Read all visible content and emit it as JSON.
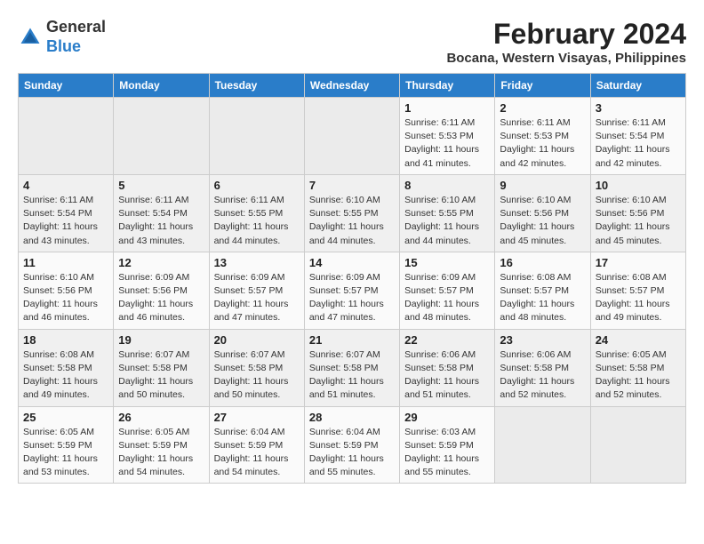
{
  "header": {
    "logo_line1": "General",
    "logo_line2": "Blue",
    "month_year": "February 2024",
    "location": "Bocana, Western Visayas, Philippines"
  },
  "weekdays": [
    "Sunday",
    "Monday",
    "Tuesday",
    "Wednesday",
    "Thursday",
    "Friday",
    "Saturday"
  ],
  "weeks": [
    [
      {
        "day": "",
        "info": ""
      },
      {
        "day": "",
        "info": ""
      },
      {
        "day": "",
        "info": ""
      },
      {
        "day": "",
        "info": ""
      },
      {
        "day": "1",
        "info": "Sunrise: 6:11 AM\nSunset: 5:53 PM\nDaylight: 11 hours\nand 41 minutes."
      },
      {
        "day": "2",
        "info": "Sunrise: 6:11 AM\nSunset: 5:53 PM\nDaylight: 11 hours\nand 42 minutes."
      },
      {
        "day": "3",
        "info": "Sunrise: 6:11 AM\nSunset: 5:54 PM\nDaylight: 11 hours\nand 42 minutes."
      }
    ],
    [
      {
        "day": "4",
        "info": "Sunrise: 6:11 AM\nSunset: 5:54 PM\nDaylight: 11 hours\nand 43 minutes."
      },
      {
        "day": "5",
        "info": "Sunrise: 6:11 AM\nSunset: 5:54 PM\nDaylight: 11 hours\nand 43 minutes."
      },
      {
        "day": "6",
        "info": "Sunrise: 6:11 AM\nSunset: 5:55 PM\nDaylight: 11 hours\nand 44 minutes."
      },
      {
        "day": "7",
        "info": "Sunrise: 6:10 AM\nSunset: 5:55 PM\nDaylight: 11 hours\nand 44 minutes."
      },
      {
        "day": "8",
        "info": "Sunrise: 6:10 AM\nSunset: 5:55 PM\nDaylight: 11 hours\nand 44 minutes."
      },
      {
        "day": "9",
        "info": "Sunrise: 6:10 AM\nSunset: 5:56 PM\nDaylight: 11 hours\nand 45 minutes."
      },
      {
        "day": "10",
        "info": "Sunrise: 6:10 AM\nSunset: 5:56 PM\nDaylight: 11 hours\nand 45 minutes."
      }
    ],
    [
      {
        "day": "11",
        "info": "Sunrise: 6:10 AM\nSunset: 5:56 PM\nDaylight: 11 hours\nand 46 minutes."
      },
      {
        "day": "12",
        "info": "Sunrise: 6:09 AM\nSunset: 5:56 PM\nDaylight: 11 hours\nand 46 minutes."
      },
      {
        "day": "13",
        "info": "Sunrise: 6:09 AM\nSunset: 5:57 PM\nDaylight: 11 hours\nand 47 minutes."
      },
      {
        "day": "14",
        "info": "Sunrise: 6:09 AM\nSunset: 5:57 PM\nDaylight: 11 hours\nand 47 minutes."
      },
      {
        "day": "15",
        "info": "Sunrise: 6:09 AM\nSunset: 5:57 PM\nDaylight: 11 hours\nand 48 minutes."
      },
      {
        "day": "16",
        "info": "Sunrise: 6:08 AM\nSunset: 5:57 PM\nDaylight: 11 hours\nand 48 minutes."
      },
      {
        "day": "17",
        "info": "Sunrise: 6:08 AM\nSunset: 5:57 PM\nDaylight: 11 hours\nand 49 minutes."
      }
    ],
    [
      {
        "day": "18",
        "info": "Sunrise: 6:08 AM\nSunset: 5:58 PM\nDaylight: 11 hours\nand 49 minutes."
      },
      {
        "day": "19",
        "info": "Sunrise: 6:07 AM\nSunset: 5:58 PM\nDaylight: 11 hours\nand 50 minutes."
      },
      {
        "day": "20",
        "info": "Sunrise: 6:07 AM\nSunset: 5:58 PM\nDaylight: 11 hours\nand 50 minutes."
      },
      {
        "day": "21",
        "info": "Sunrise: 6:07 AM\nSunset: 5:58 PM\nDaylight: 11 hours\nand 51 minutes."
      },
      {
        "day": "22",
        "info": "Sunrise: 6:06 AM\nSunset: 5:58 PM\nDaylight: 11 hours\nand 51 minutes."
      },
      {
        "day": "23",
        "info": "Sunrise: 6:06 AM\nSunset: 5:58 PM\nDaylight: 11 hours\nand 52 minutes."
      },
      {
        "day": "24",
        "info": "Sunrise: 6:05 AM\nSunset: 5:58 PM\nDaylight: 11 hours\nand 52 minutes."
      }
    ],
    [
      {
        "day": "25",
        "info": "Sunrise: 6:05 AM\nSunset: 5:59 PM\nDaylight: 11 hours\nand 53 minutes."
      },
      {
        "day": "26",
        "info": "Sunrise: 6:05 AM\nSunset: 5:59 PM\nDaylight: 11 hours\nand 54 minutes."
      },
      {
        "day": "27",
        "info": "Sunrise: 6:04 AM\nSunset: 5:59 PM\nDaylight: 11 hours\nand 54 minutes."
      },
      {
        "day": "28",
        "info": "Sunrise: 6:04 AM\nSunset: 5:59 PM\nDaylight: 11 hours\nand 55 minutes."
      },
      {
        "day": "29",
        "info": "Sunrise: 6:03 AM\nSunset: 5:59 PM\nDaylight: 11 hours\nand 55 minutes."
      },
      {
        "day": "",
        "info": ""
      },
      {
        "day": "",
        "info": ""
      }
    ]
  ]
}
